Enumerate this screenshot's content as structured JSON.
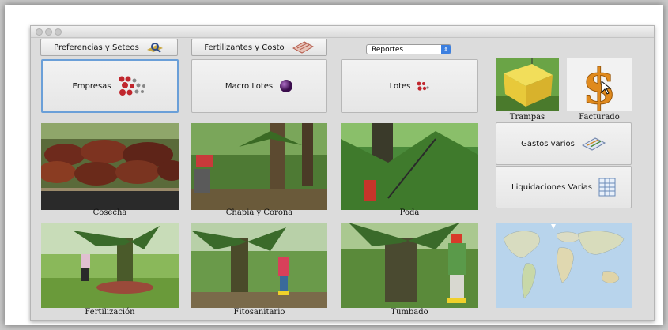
{
  "toolbar": {
    "preferences_label": "Preferencias y Seteos",
    "fertilizers_label": "Fertilizantes y Costo",
    "reports_select": "Reportes"
  },
  "tiles": {
    "empresas": "Empresas",
    "macro_lotes": "Macro Lotes",
    "lotes": "Lotes",
    "gastos_varios": "Gastos varios",
    "liquidaciones": "Liquidaciones Varias"
  },
  "icon_captions": {
    "trampas": "Trampas",
    "facturado": "Facturado"
  },
  "photos": {
    "cosecha": "Cosecha",
    "chapia": "Chapia y Corona",
    "poda": "Poda",
    "fertilizacion": "Fertilización",
    "fitosanitario": "Fitosanitario",
    "tumbado": "Tumbado"
  },
  "colors": {
    "focus_border": "#6a9fd8",
    "select_arrow": "#3b7fe0"
  }
}
